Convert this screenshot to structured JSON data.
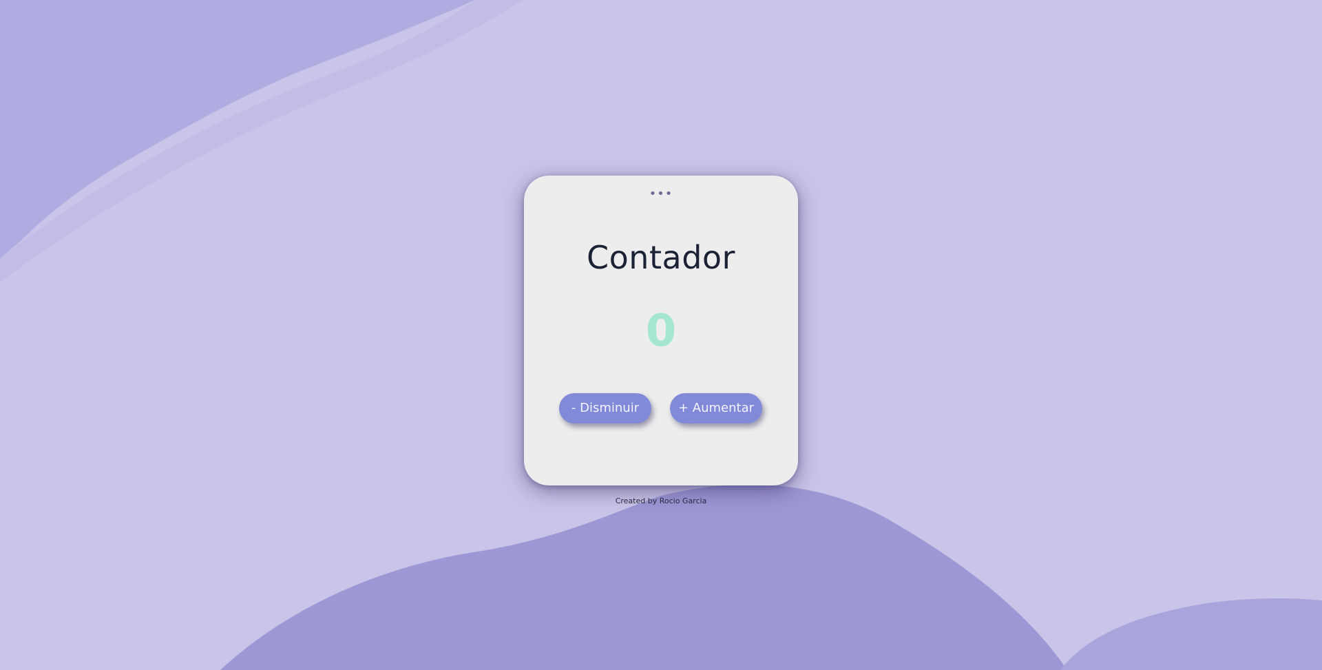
{
  "card": {
    "menu_dots": "•••",
    "title": "Contador",
    "count": "0"
  },
  "buttons": {
    "decrease": "- Disminuir",
    "increase": "+ Aumentar"
  },
  "footer": {
    "credit": "Created by Rocio Garcia"
  },
  "colors": {
    "background": "#c6c2e6",
    "card": "#ededed",
    "title": "#1b2236",
    "count": "#a4e6cf",
    "button": "#8189d9"
  }
}
